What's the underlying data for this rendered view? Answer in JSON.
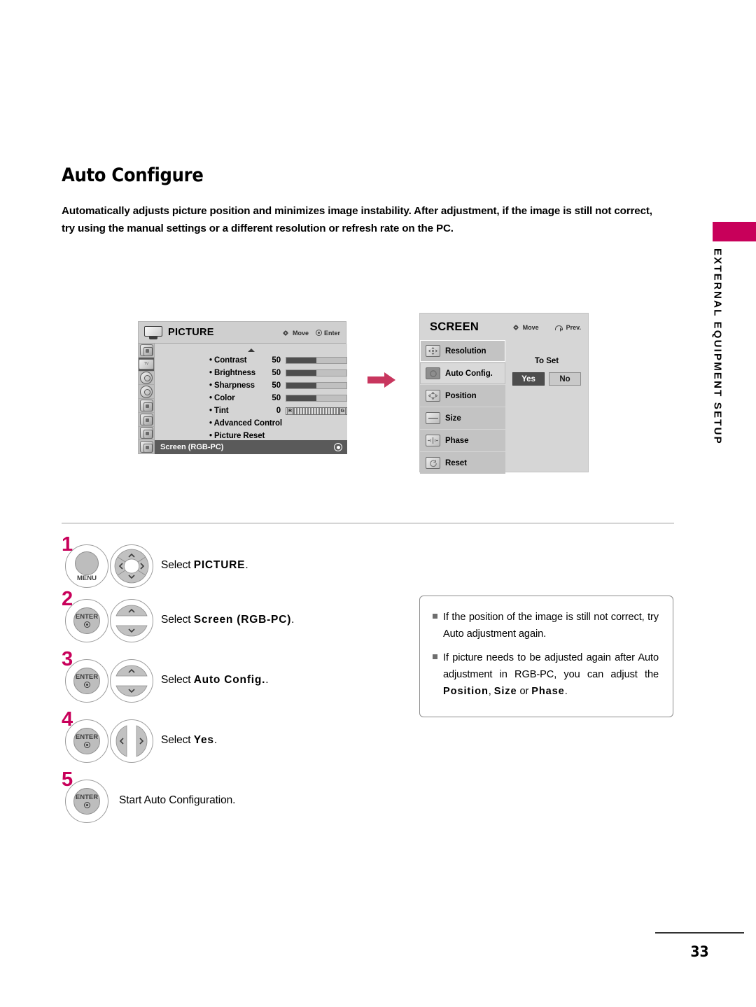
{
  "page": {
    "title": "Auto Configure",
    "intro": "Automatically adjusts picture position and minimizes image instability. After adjustment, if the image is still not correct, try using the manual settings or a different resolution or refresh rate on the PC.",
    "number": "33",
    "side_tab": "EXTERNAL EQUIPMENT SETUP",
    "accent_color": "#C8005A"
  },
  "picture_osd": {
    "title": "PICTURE",
    "hints": [
      {
        "icon": "nav-pad-icon",
        "label": "Move"
      },
      {
        "icon": "enter-icon",
        "label": "Enter"
      }
    ],
    "scroll_up_indicator": "▲",
    "items": [
      {
        "label": "• Contrast",
        "value": "50",
        "bar": 50
      },
      {
        "label": "• Brightness",
        "value": "50",
        "bar": 50
      },
      {
        "label": "• Sharpness",
        "value": "50",
        "bar": 50
      },
      {
        "label": "• Color",
        "value": "50",
        "bar": 50
      },
      {
        "label": "• Tint",
        "value": "0",
        "bar": -1,
        "left_mark": "R",
        "right_mark": "G"
      },
      {
        "label": "• Advanced Control",
        "value": "",
        "bar": -1
      },
      {
        "label": "• Picture Reset",
        "value": "",
        "bar": -1
      }
    ],
    "footer_item": "Screen (RGB-PC)",
    "sidebar_icons": [
      "audio-disc-icon",
      "picture-tv-icon",
      "time-clock-icon",
      "setup-dial-icon",
      "lock-icon",
      "usb-icon",
      "input-arrows-icon",
      "my-media-icon"
    ]
  },
  "screen_osd": {
    "title": "SCREEN",
    "hints": [
      {
        "icon": "nav-pad-icon",
        "label": "Move"
      },
      {
        "icon": "prev-return-icon",
        "label": "Prev."
      }
    ],
    "menu": [
      {
        "label": "Resolution",
        "icon": "resolution-icon",
        "state": "selected"
      },
      {
        "label": "Auto Config.",
        "icon": "auto-config-icon",
        "state": "highlight"
      },
      {
        "label": "Position",
        "icon": "position-icon",
        "state": "normal"
      },
      {
        "label": "Size",
        "icon": "size-icon",
        "state": "normal"
      },
      {
        "label": "Phase",
        "icon": "phase-icon",
        "state": "normal"
      },
      {
        "label": "Reset",
        "icon": "reset-icon",
        "state": "normal"
      }
    ],
    "to_set_label": "To Set",
    "yes_label": "Yes",
    "no_label": "No",
    "selected_option": "Yes"
  },
  "flow": {
    "arrow": "right-arrow-icon"
  },
  "steps": [
    {
      "number": "1",
      "buttons": [
        "menu-button",
        "dpad-4way"
      ],
      "text_prefix": "Select ",
      "text_bold": "PICTURE",
      "text_suffix": ".",
      "menu_label": "MENU"
    },
    {
      "number": "2",
      "buttons": [
        "enter-button",
        "updown-rocker"
      ],
      "text_prefix": "Select ",
      "text_bold": "Screen (RGB-PC)",
      "text_suffix": ".",
      "enter_label": "ENTER"
    },
    {
      "number": "3",
      "buttons": [
        "enter-button",
        "updown-rocker"
      ],
      "text_prefix": "Select ",
      "text_bold": "Auto Config.",
      "text_suffix": ".",
      "enter_label": "ENTER"
    },
    {
      "number": "4",
      "buttons": [
        "enter-button",
        "leftright-rocker"
      ],
      "text_prefix": "Select ",
      "text_bold": "Yes",
      "text_suffix": ".",
      "enter_label": "ENTER"
    },
    {
      "number": "5",
      "buttons": [
        "enter-button"
      ],
      "text_prefix": "Start Auto Configuration.",
      "text_bold": "",
      "text_suffix": "",
      "enter_label": "ENTER"
    }
  ],
  "notes": [
    {
      "segments": [
        {
          "text": "If the position of the image is still not correct, try Auto adjustment again.",
          "bold": false
        }
      ]
    },
    {
      "segments": [
        {
          "text": "If picture needs to be adjusted again after Auto adjustment in RGB-PC, you can adjust the ",
          "bold": false
        },
        {
          "text": "Position",
          "bold": true
        },
        {
          "text": ", ",
          "bold": false
        },
        {
          "text": "Size",
          "bold": true
        },
        {
          "text": " or ",
          "bold": false
        },
        {
          "text": "Phase",
          "bold": true
        },
        {
          "text": ".",
          "bold": false
        }
      ]
    }
  ]
}
